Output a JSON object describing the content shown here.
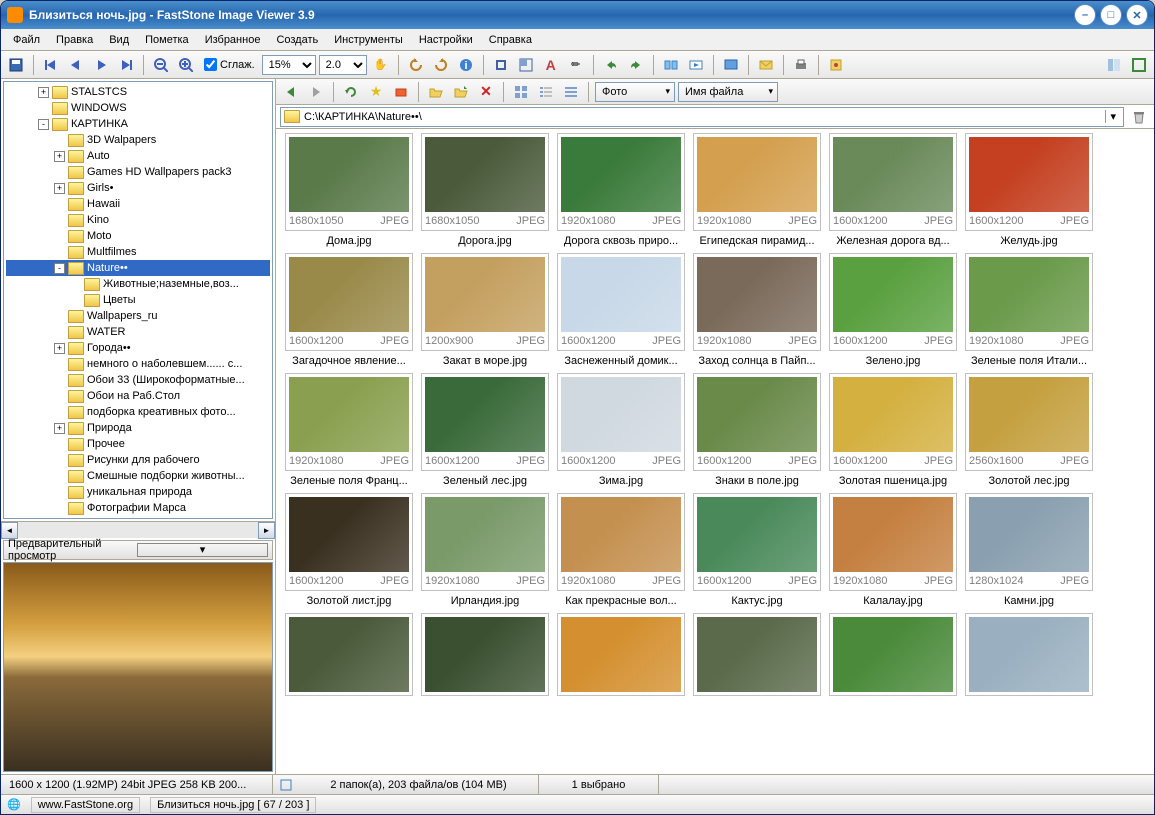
{
  "title": "Близиться ночь.jpg  -  FastStone Image Viewer 3.9",
  "menu": [
    "Файл",
    "Правка",
    "Вид",
    "Пометка",
    "Избранное",
    "Создать",
    "Инструменты",
    "Настройки",
    "Справка"
  ],
  "toolbar1": {
    "zoom_pct": "15%",
    "zoom_step": "2.0",
    "smooth_label": "Сглаж."
  },
  "tree": [
    {
      "lvl": 2,
      "exp": "+",
      "label": "STALSTCS"
    },
    {
      "lvl": 2,
      "exp": "",
      "label": "WINDOWS"
    },
    {
      "lvl": 2,
      "exp": "-",
      "label": "КАРТИНКА"
    },
    {
      "lvl": 3,
      "exp": "",
      "label": "3D Walpapers"
    },
    {
      "lvl": 3,
      "exp": "+",
      "label": "Auto"
    },
    {
      "lvl": 3,
      "exp": "",
      "label": "Games HD Wallpapers pack3"
    },
    {
      "lvl": 3,
      "exp": "+",
      "label": "Girls•"
    },
    {
      "lvl": 3,
      "exp": "",
      "label": "Hawaii"
    },
    {
      "lvl": 3,
      "exp": "",
      "label": "Kino"
    },
    {
      "lvl": 3,
      "exp": "",
      "label": "Moto"
    },
    {
      "lvl": 3,
      "exp": "",
      "label": "Multfilmes"
    },
    {
      "lvl": 3,
      "exp": "-",
      "label": "Nature••",
      "sel": true
    },
    {
      "lvl": 4,
      "exp": "",
      "label": "Животные;наземные,воз..."
    },
    {
      "lvl": 4,
      "exp": "",
      "label": "Цветы"
    },
    {
      "lvl": 3,
      "exp": "",
      "label": "Wallpapers_ru"
    },
    {
      "lvl": 3,
      "exp": "",
      "label": "WATER"
    },
    {
      "lvl": 3,
      "exp": "+",
      "label": "Города••"
    },
    {
      "lvl": 3,
      "exp": "",
      "label": "немного о наболевшем...... с..."
    },
    {
      "lvl": 3,
      "exp": "",
      "label": "Обои 33 (Широкоформатные..."
    },
    {
      "lvl": 3,
      "exp": "",
      "label": "Обои на Раб.Стол"
    },
    {
      "lvl": 3,
      "exp": "",
      "label": "подборка креативных фото..."
    },
    {
      "lvl": 3,
      "exp": "+",
      "label": "Природа"
    },
    {
      "lvl": 3,
      "exp": "",
      "label": "Прочее"
    },
    {
      "lvl": 3,
      "exp": "",
      "label": "Рисунки для рабочего"
    },
    {
      "lvl": 3,
      "exp": "",
      "label": "Смешные подборки животны..."
    },
    {
      "lvl": 3,
      "exp": "",
      "label": "уникальная природа"
    },
    {
      "lvl": 3,
      "exp": "",
      "label": "Фотографии Марса"
    }
  ],
  "preview_label": "Предварительный просмотр",
  "path": "C:\\КАРТИНКА\\Nature••\\",
  "view_combo1": "Фото",
  "view_combo2": "Имя файла",
  "thumbs": [
    {
      "res": "1680x1050",
      "fmt": "JPEG",
      "name": "Дома.jpg",
      "c": "#5a7a4a"
    },
    {
      "res": "1680x1050",
      "fmt": "JPEG",
      "name": "Дорога.jpg",
      "c": "#4a5a3a"
    },
    {
      "res": "1920x1080",
      "fmt": "JPEG",
      "name": "Дорога сквозь приро...",
      "c": "#3a7a3a"
    },
    {
      "res": "1920x1080",
      "fmt": "JPEG",
      "name": "Египедская пирамид...",
      "c": "#d4a050"
    },
    {
      "res": "1600x1200",
      "fmt": "JPEG",
      "name": "Железная дорога вд...",
      "c": "#6a8a5a"
    },
    {
      "res": "1600x1200",
      "fmt": "JPEG",
      "name": "Желудь.jpg",
      "c": "#c44020"
    },
    {
      "res": "1600x1200",
      "fmt": "JPEG",
      "name": "Загадочное явление...",
      "c": "#9a8a4a"
    },
    {
      "res": "1200x900",
      "fmt": "JPEG",
      "name": "Закат в море.jpg",
      "c": "#c4a060"
    },
    {
      "res": "1600x1200",
      "fmt": "JPEG",
      "name": "Заснеженный домик...",
      "c": "#c8d8e8"
    },
    {
      "res": "1920x1080",
      "fmt": "JPEG",
      "name": "Заход солнца в Пайп...",
      "c": "#7a6a5a"
    },
    {
      "res": "1600x1200",
      "fmt": "JPEG",
      "name": "Зелено.jpg",
      "c": "#5aa040"
    },
    {
      "res": "1920x1080",
      "fmt": "JPEG",
      "name": "Зеленые поля Итали...",
      "c": "#6a9a4a"
    },
    {
      "res": "1920x1080",
      "fmt": "JPEG",
      "name": "Зеленые поля Франц...",
      "c": "#8aa050"
    },
    {
      "res": "1600x1200",
      "fmt": "JPEG",
      "name": "Зеленый лес.jpg",
      "c": "#3a6a3a"
    },
    {
      "res": "1600x1200",
      "fmt": "JPEG",
      "name": "Зима.jpg",
      "c": "#d0d8e0"
    },
    {
      "res": "1600x1200",
      "fmt": "JPEG",
      "name": "Знаки в поле.jpg",
      "c": "#6a8a4a"
    },
    {
      "res": "1600x1200",
      "fmt": "JPEG",
      "name": "Золотая пшеница.jpg",
      "c": "#d4b040"
    },
    {
      "res": "2560x1600",
      "fmt": "JPEG",
      "name": "Золотой лес.jpg",
      "c": "#c4a040"
    },
    {
      "res": "1600x1200",
      "fmt": "JPEG",
      "name": "Золотой лист.jpg",
      "c": "#3a3020"
    },
    {
      "res": "1920x1080",
      "fmt": "JPEG",
      "name": "Ирландия.jpg",
      "c": "#7a9a6a"
    },
    {
      "res": "1920x1080",
      "fmt": "JPEG",
      "name": "Как прекрасные вол...",
      "c": "#c49050"
    },
    {
      "res": "1600x1200",
      "fmt": "JPEG",
      "name": "Кактус.jpg",
      "c": "#4a8a5a"
    },
    {
      "res": "1920x1080",
      "fmt": "JPEG",
      "name": "Калалау.jpg",
      "c": "#c48040"
    },
    {
      "res": "1280x1024",
      "fmt": "JPEG",
      "name": "Камни.jpg",
      "c": "#8aa0b0"
    },
    {
      "res": "",
      "fmt": "",
      "name": "",
      "c": "#4a5a3a"
    },
    {
      "res": "",
      "fmt": "",
      "name": "",
      "c": "#3a5030"
    },
    {
      "res": "",
      "fmt": "",
      "name": "",
      "c": "#d49030"
    },
    {
      "res": "",
      "fmt": "",
      "name": "",
      "c": "#5a6a4a"
    },
    {
      "res": "",
      "fmt": "",
      "name": "",
      "c": "#4a8a3a"
    },
    {
      "res": "",
      "fmt": "",
      "name": "",
      "c": "#9ab0c0"
    }
  ],
  "status": {
    "dim": "1600 x 1200 (1.92MP)  24bit JPEG  258 KB  200...",
    "folder": "2 папок(а), 203 файла/ов (104 MB)",
    "sel": "1 выбрано"
  },
  "bottom": {
    "site": "www.FastStone.org",
    "file": "Близиться ночь.jpg [ 67 / 203 ]"
  }
}
